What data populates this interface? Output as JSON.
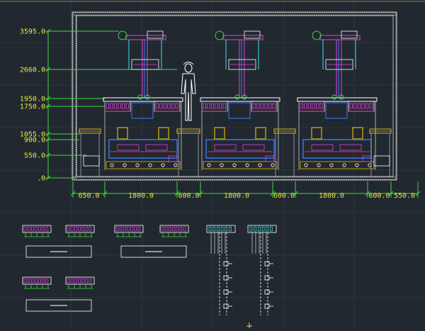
{
  "drawing": {
    "elevation_labels": [
      "3595.0",
      "2660.0",
      "1950.0",
      "1750.0",
      "1055.0",
      "900.0",
      "550.0",
      ".0"
    ],
    "dimension_labels": [
      "650.0",
      "1800.0",
      "600.0",
      "1800.0",
      "600.0",
      "1800.0",
      "600.0",
      "550.0"
    ],
    "colors": {
      "background": "#212830",
      "frame": "#c8c8c8",
      "dimension": "#e6e63c",
      "leader": "#3cdc3c",
      "equipment_blue": "#3c78ff",
      "equipment_magenta": "#e040e0",
      "equipment_yellow": "#e6b400",
      "cyan": "#3ce6e6",
      "red": "#e03c3c",
      "white": "#ffffff"
    },
    "icons": [
      "human-figure-icon",
      "motor-icon"
    ]
  }
}
